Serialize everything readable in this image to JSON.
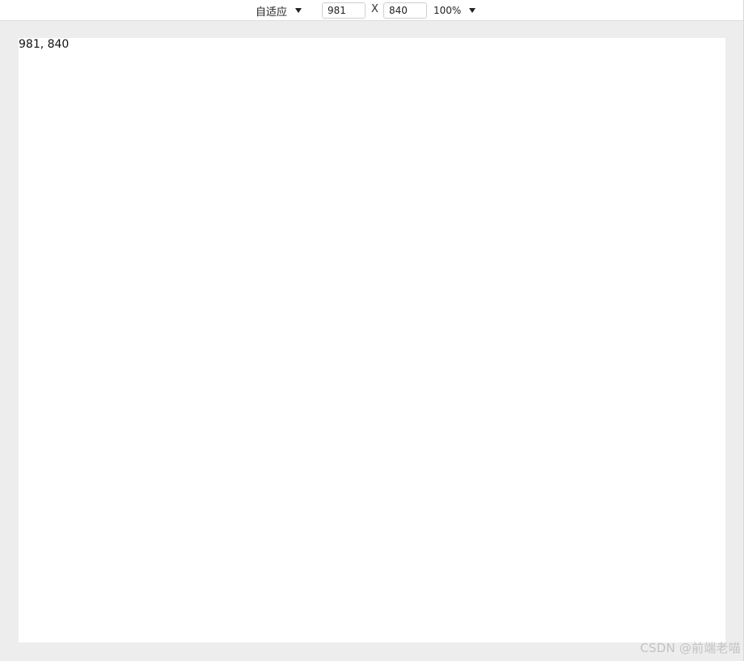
{
  "toolbar": {
    "device_label": "自适应",
    "width_value": "981",
    "times_label": "X",
    "height_value": "840",
    "zoom_label": "100%"
  },
  "viewport": {
    "size_text": "981, 840"
  },
  "watermark": "CSDN @前端老喵"
}
